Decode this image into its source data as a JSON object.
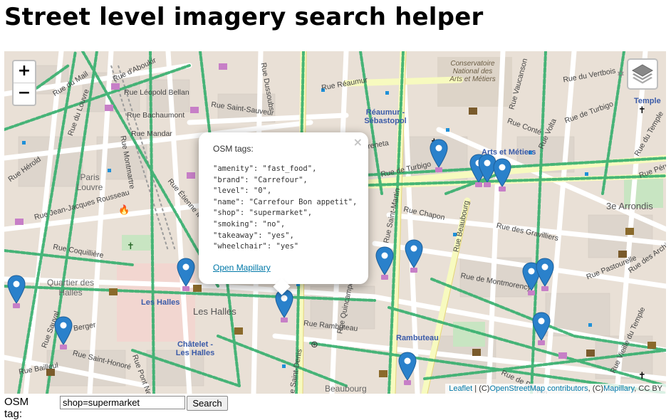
{
  "page": {
    "title": "Street level imagery search helper"
  },
  "map": {
    "zoom_in": "+",
    "zoom_out": "−",
    "layers_icon": "layers-icon",
    "street_labels": [
      "Rue du Mail",
      "Rue d'Aboukir",
      "Rue Léopold Bellan",
      "Rue Bachaumont",
      "Rue Saint-Sauveur",
      "Rue Mandar",
      "Rue Dussoubs",
      "Rue Réaumur",
      "Rue de Turbigo",
      "Rue Greneta",
      "Rue Chapon",
      "Rue Beaubourg",
      "Rue des Gravilliers",
      "Rue de Montmorency",
      "Rue Rambuteau",
      "Rue Quincampoix",
      "Rue Saint-Martin",
      "Rue Coquillière",
      "Rue Berger",
      "Rue Saint-Honoré",
      "Rue Jean-Jacques Rousseau",
      "Rue du Louvre",
      "Rue Hérold",
      "Rue Montmartre",
      "Rue Vaucanson",
      "Rue Conté",
      "Rue Volta",
      "Rue du Vertbois",
      "Rue Pérrée",
      "Rue Pastourelle",
      "Rue des Archives",
      "Rue de Braque",
      "Rue Vieille du Temple",
      "Rue du Temple",
      "Rue Bailleul",
      "Rue Sauval",
      "Rue Pont Neuf",
      "Rue Saint-Denis",
      "Rue Étienne Marcel"
    ],
    "place_labels": [
      "Paris Louvre",
      "Quartier des Halles",
      "Les Halles",
      "3e Arrondis",
      "Conservatoire National des Arts et Métiers",
      "Beaubourg"
    ],
    "station_labels": [
      "Réaumur - Sébastopol",
      "Arts et Métiers",
      "Les Halles",
      "Châtelet - Les Halles",
      "Rambuteau",
      "Temple"
    ],
    "attribution": {
      "leaflet": "Leaflet",
      "sep1": " | (C)",
      "osm": "OpenStreetMap contributors",
      "sep2": ", (C)",
      "mapillary": "Mapillary",
      "license": ", CC BY"
    }
  },
  "popup": {
    "close": "×",
    "title": "OSM tags:",
    "tags": "\"amenity\": \"fast_food\",\n\"brand\": \"Carrefour\",\n\"level\": \"0\",\n\"name\": \"Carrefour Bon appetit\",\n\"shop\": \"supermarket\",\n\"smoking\": \"no\",\n\"takeaway\": \"yes\",\n\"wheelchair\": \"yes\"",
    "link": "Open Mapillary"
  },
  "form": {
    "label": "OSM tag:",
    "value": "shop=supermarket",
    "button": "Search"
  },
  "colors": {
    "marker": "#2a81cb",
    "marker_dark": "#1e5f99",
    "mapillary_green": "#35af6d",
    "road_yellow": "#f7fabf",
    "water_icon": "#3b5ba8"
  }
}
